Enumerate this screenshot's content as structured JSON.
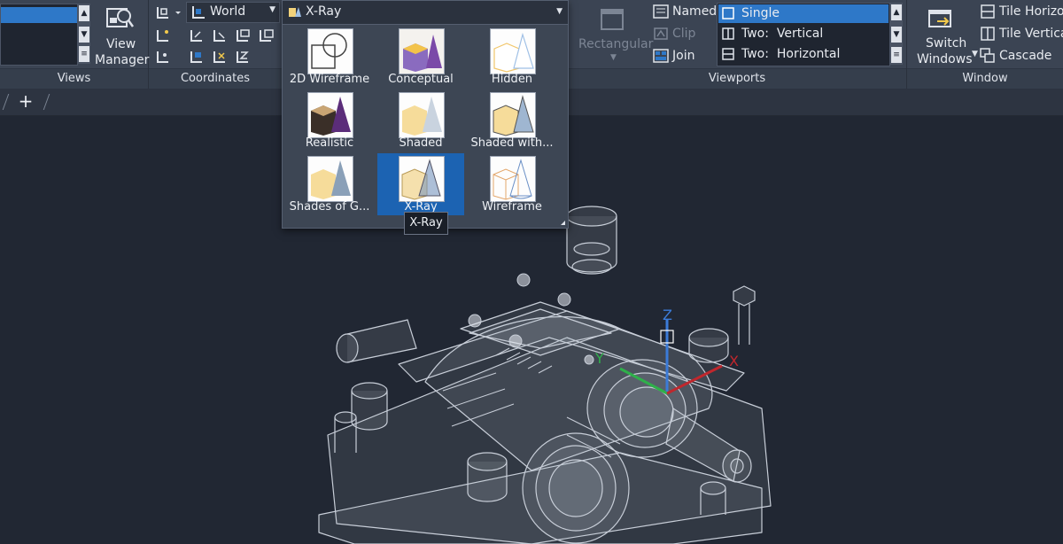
{
  "ribbon": {
    "views": {
      "title": "Views",
      "view_manager_label_1": "View",
      "view_manager_label_2": "Manager"
    },
    "coordinates": {
      "title": "Coordinates",
      "ucs_value": "World"
    },
    "visual_style": {
      "current": "X-Ray"
    },
    "viewports": {
      "title": "Viewports",
      "rectangular_label": "Rectangular",
      "named_label": "Named",
      "clip_label": "Clip",
      "join_label": "Join",
      "config_items": [
        {
          "label": "Single"
        },
        {
          "label": "Two:  Vertical"
        },
        {
          "label": "Two:  Horizontal"
        }
      ]
    },
    "window": {
      "title": "Window",
      "switch_label_1": "Switch",
      "switch_label_2": "Windows",
      "tile_horizontal": "Tile Horizon",
      "tile_vertical": "Tile Vertical",
      "cascade": "Cascade"
    }
  },
  "tabs": {
    "add": "+"
  },
  "gallery": {
    "items": [
      {
        "label": "2D Wireframe",
        "icon": "2d-wireframe-icon"
      },
      {
        "label": "Conceptual",
        "icon": "conceptual-icon"
      },
      {
        "label": "Hidden",
        "icon": "hidden-icon"
      },
      {
        "label": "Realistic",
        "icon": "realistic-icon"
      },
      {
        "label": "Shaded",
        "icon": "shaded-icon"
      },
      {
        "label": "Shaded with...",
        "icon": "shaded-with-edges-icon"
      },
      {
        "label": "Shades of G...",
        "icon": "shades-of-gray-icon"
      },
      {
        "label": "X-Ray",
        "icon": "x-ray-icon"
      },
      {
        "label": "Wireframe",
        "icon": "wireframe-icon"
      }
    ],
    "tooltip": "X-Ray"
  },
  "ucs_axes": {
    "x": "X",
    "y": "Y",
    "z": "Z"
  },
  "colors": {
    "ribbon": "#3b4453",
    "canvas": "#212733",
    "accent": "#2e78c8",
    "model": "#c8ced8"
  }
}
